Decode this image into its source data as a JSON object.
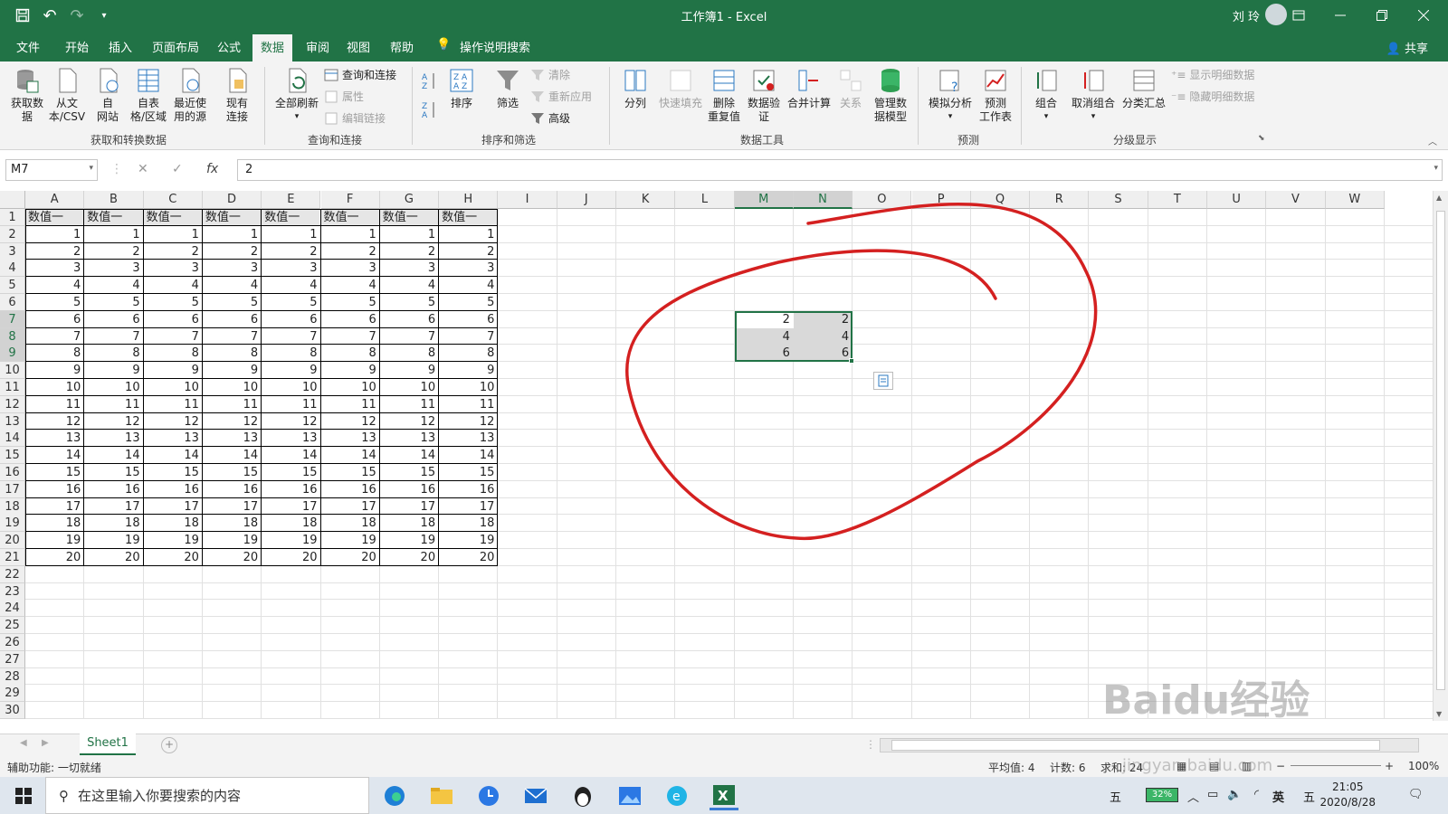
{
  "window": {
    "title": "工作簿1  -  Excel",
    "user": "刘 玲",
    "undo_glyph": "↶",
    "redo_glyph": "↷",
    "save_icon": "save-icon"
  },
  "menu": {
    "tabs": [
      "文件",
      "开始",
      "插入",
      "页面布局",
      "公式",
      "数据",
      "审阅",
      "视图",
      "帮助"
    ],
    "active_tab": "数据",
    "tell_me": "操作说明搜索",
    "share": "共享"
  },
  "ribbon": {
    "groups": {
      "get_transform": "获取和转换数据",
      "queries": "查询和连接",
      "sort_filter": "排序和筛选",
      "data_tools": "数据工具",
      "forecast": "预测",
      "outline": "分级显示"
    },
    "get_data": "获取数\n据",
    "from_text": "从文\n本/CSV",
    "from_web": "自\n网站",
    "from_table": "自表\n格/区域",
    "recent_sources": "最近使\n用的源",
    "existing_conn": "现有\n连接",
    "refresh_all": "全部刷新",
    "queries_connections": "查询和连接",
    "properties": "属性",
    "edit_links": "编辑链接",
    "sort": "排序",
    "filter": "筛选",
    "clear": "清除",
    "reapply": "重新应用",
    "advanced": "高级",
    "text_to_columns": "分列",
    "flash_fill": "快速填充",
    "remove_duplicates": "删除\n重复值",
    "data_validation": "数据验\n证",
    "consolidate": "合并计算",
    "relationships": "关系",
    "manage_model": "管理数\n据模型",
    "what_if": "模拟分析",
    "forecast_sheet": "预测\n工作表",
    "group": "组合",
    "ungroup": "取消组合",
    "subtotal": "分类汇总",
    "show_detail": "显示明细数据",
    "hide_detail": "隐藏明细数据"
  },
  "formula_bar": {
    "name_box": "M7",
    "cancel": "✕",
    "enter": "✓",
    "fx": "fx",
    "value": "2"
  },
  "columns": [
    "A",
    "B",
    "C",
    "D",
    "E",
    "F",
    "G",
    "H",
    "I",
    "J",
    "K",
    "L",
    "M",
    "N",
    "O",
    "P",
    "Q",
    "R",
    "S",
    "T",
    "U",
    "V",
    "W"
  ],
  "rows": [
    "1",
    "2",
    "3",
    "4",
    "5",
    "6",
    "7",
    "8",
    "9",
    "10",
    "11",
    "12",
    "13",
    "14",
    "15",
    "16",
    "17",
    "18",
    "19",
    "20",
    "21",
    "22",
    "23",
    "24",
    "25",
    "26",
    "27",
    "28",
    "29",
    "30"
  ],
  "table": {
    "header": [
      "数值一",
      "数值一",
      "数值一",
      "数值一",
      "数值一",
      "数值一",
      "数值一",
      "数值一"
    ],
    "values": [
      1,
      2,
      3,
      4,
      5,
      6,
      7,
      8,
      9,
      10,
      11,
      12,
      13,
      14,
      15,
      16,
      17,
      18,
      19,
      20
    ]
  },
  "selection": {
    "rows": [
      [
        2,
        2
      ],
      [
        4,
        4
      ],
      [
        6,
        6
      ]
    ]
  },
  "sheets": {
    "active": "Sheet1",
    "add": "+"
  },
  "status": {
    "accessibility": "辅助功能: 一切就绪",
    "average": "平均值: 4",
    "count": "计数: 6",
    "sum": "求和: 24",
    "zoom": "100%"
  },
  "taskbar": {
    "search_placeholder": "在这里输入你要搜索的内容",
    "ime_1": "五",
    "battery": "32%",
    "ime_lang": "英",
    "ime_2": "五",
    "time": "21:05",
    "date": "2020/8/28"
  },
  "watermark": {
    "brand": "Baidu经验",
    "url": "jingyan.baidu.com"
  },
  "colors": {
    "excel_green": "#217346",
    "annotation_red": "#d42020",
    "selection_gray": "#d9d9d9"
  }
}
